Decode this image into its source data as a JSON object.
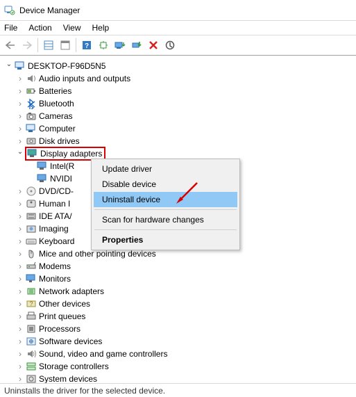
{
  "window": {
    "title": "Device Manager"
  },
  "menu": {
    "file": "File",
    "action": "Action",
    "view": "View",
    "help": "Help"
  },
  "root": {
    "name": "DESKTOP-F96D5N5"
  },
  "categories": [
    {
      "id": "audio",
      "label": "Audio inputs and outputs",
      "open": false
    },
    {
      "id": "batteries",
      "label": "Batteries",
      "open": false
    },
    {
      "id": "bluetooth",
      "label": "Bluetooth",
      "open": false
    },
    {
      "id": "cameras",
      "label": "Cameras",
      "open": false
    },
    {
      "id": "computer",
      "label": "Computer",
      "open": false
    },
    {
      "id": "diskdrives",
      "label": "Disk drives",
      "open": false
    },
    {
      "id": "display",
      "label": "Display adapters",
      "open": true,
      "children": [
        {
          "id": "intel",
          "label": "Intel(R"
        },
        {
          "id": "nvidia",
          "label": "NVIDI"
        }
      ]
    },
    {
      "id": "dvd",
      "label": "DVD/CD-",
      "open": false
    },
    {
      "id": "hid",
      "label": "Human I",
      "open": false
    },
    {
      "id": "ide",
      "label": "IDE ATA/",
      "open": false
    },
    {
      "id": "imaging",
      "label": "Imaging ",
      "open": false
    },
    {
      "id": "keyboard",
      "label": "Keyboard",
      "open": false
    },
    {
      "id": "mice",
      "label": "Mice and other pointing devices",
      "open": false
    },
    {
      "id": "modems",
      "label": "Modems",
      "open": false
    },
    {
      "id": "monitors",
      "label": "Monitors",
      "open": false
    },
    {
      "id": "netadapters",
      "label": "Network adapters",
      "open": false
    },
    {
      "id": "other",
      "label": "Other devices",
      "open": false
    },
    {
      "id": "printq",
      "label": "Print queues",
      "open": false
    },
    {
      "id": "processors",
      "label": "Processors",
      "open": false
    },
    {
      "id": "softdev",
      "label": "Software devices",
      "open": false
    },
    {
      "id": "sound",
      "label": "Sound, video and game controllers",
      "open": false
    },
    {
      "id": "storage",
      "label": "Storage controllers",
      "open": false
    },
    {
      "id": "sysdev",
      "label": "System devices",
      "open": false
    }
  ],
  "context_menu": {
    "update": "Update driver",
    "disable": "Disable device",
    "uninstall": "Uninstall device",
    "scan": "Scan for hardware changes",
    "properties": "Properties"
  },
  "status": "Uninstalls the driver for the selected device."
}
